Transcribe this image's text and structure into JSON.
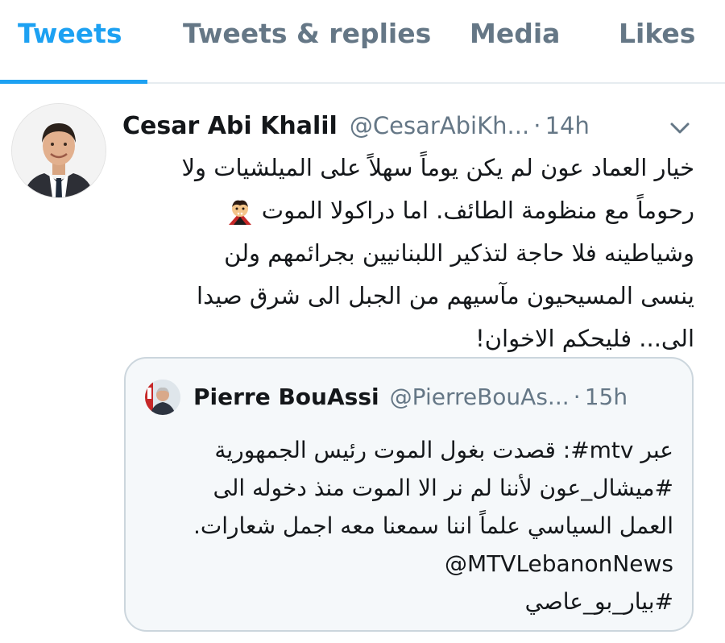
{
  "tabs": [
    {
      "label": "Tweets",
      "active": true
    },
    {
      "label": "Tweets & replies",
      "active": false
    },
    {
      "label": "Media",
      "active": false
    },
    {
      "label": "Likes",
      "active": false
    }
  ],
  "tweet": {
    "author_name": "Cesar Abi Khalil",
    "handle": "@CesarAbiKh...",
    "separator": "·",
    "time": "14h",
    "lines": [
      "خيار العماد عون لم يكن يوماً سهلاً على الميلشيات ولا",
      "رحوماً مع منظومة الطائف. اما دراكولا الموت",
      "وشياطينه فلا حاجة لتذكير اللبنانيين بجرائمهم ولن",
      "ينسى المسيحيون مآسيهم من الجبل الى شرق صيدا",
      "الى... فليحكم الاخوان!"
    ],
    "emoji": "vampire-emoji"
  },
  "quote": {
    "author_name": "Pierre BouAssi",
    "handle": "@PierreBouAs...",
    "separator": "·",
    "time": "15h",
    "lines": [
      "عبر mtv#: قصدت بغول الموت رئيس الجمهورية",
      "#ميشال_عون لأننا لم نر الا الموت منذ دخوله الى",
      "العمل السياسي علماً اننا سمعنا معه اجمل شعارات.",
      "@MTVLebanonNews",
      "#بيار_بو_عاصي"
    ]
  },
  "colors": {
    "accent": "#1da1f2",
    "muted": "#657786",
    "border": "#ccd6dd"
  }
}
